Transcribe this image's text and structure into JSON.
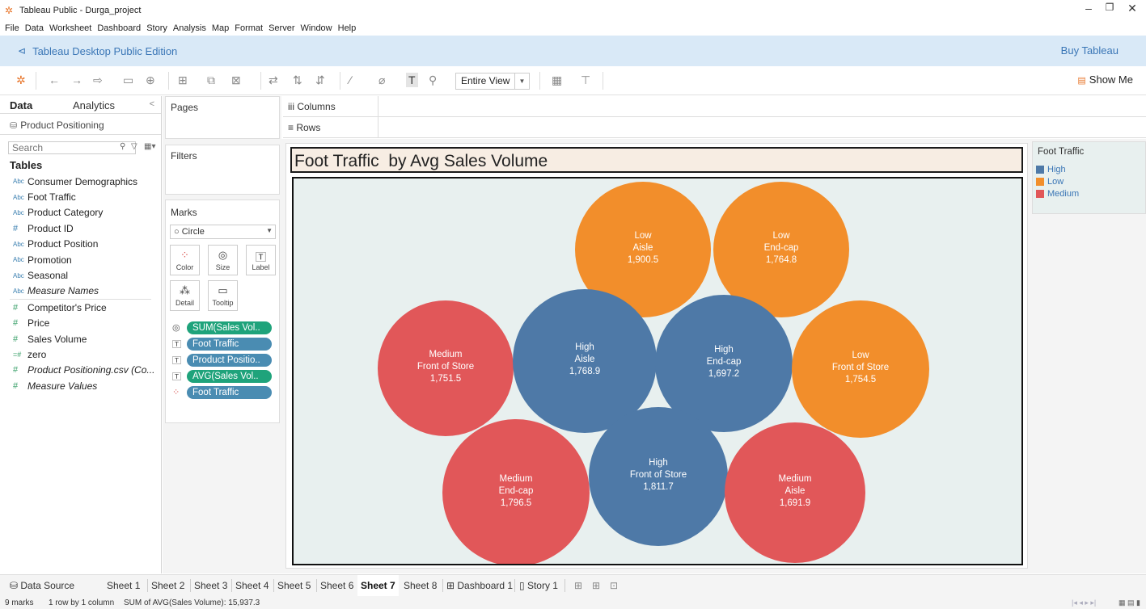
{
  "window": {
    "title": "Tableau Public - Durga_project",
    "icon": "tableau-logo-icon"
  },
  "menu": [
    "File",
    "Data",
    "Worksheet",
    "Dashboard",
    "Story",
    "Analysis",
    "Map",
    "Format",
    "Server",
    "Window",
    "Help"
  ],
  "edition": {
    "label": "Tableau Desktop Public Edition",
    "buy": "Buy Tableau"
  },
  "toolbar": {
    "fit": "Entire View",
    "show_me": "Show Me"
  },
  "data_pane": {
    "tab_data": "Data",
    "tab_analytics": "Analytics",
    "datasource": "Product Positioning",
    "search_placeholder": "Search",
    "tables_heading": "Tables",
    "dimensions": [
      {
        "type": "Abc",
        "name": "Consumer Demographics"
      },
      {
        "type": "Abc",
        "name": "Foot Traffic"
      },
      {
        "type": "Abc",
        "name": "Product Category"
      },
      {
        "type": "#",
        "name": "Product ID"
      },
      {
        "type": "Abc",
        "name": "Product Position"
      },
      {
        "type": "Abc",
        "name": "Promotion"
      },
      {
        "type": "Abc",
        "name": "Seasonal"
      },
      {
        "type": "Abc",
        "name": "Measure Names"
      }
    ],
    "measures": [
      {
        "type": "#",
        "name": "Competitor's Price"
      },
      {
        "type": "#",
        "name": "Price"
      },
      {
        "type": "#",
        "name": "Sales Volume"
      },
      {
        "type": "=#",
        "name": "zero"
      },
      {
        "type": "#",
        "name": "Product Positioning.csv (Co..."
      },
      {
        "type": "#",
        "name": "Measure Values"
      }
    ]
  },
  "cards": {
    "pages": "Pages",
    "filters": "Filters",
    "marks": "Marks",
    "mark_type": "Circle",
    "buttons": {
      "color": "Color",
      "size": "Size",
      "label": "Label",
      "detail": "Detail",
      "tooltip": "Tooltip"
    },
    "pills": [
      {
        "icon": "size-icon",
        "text": "SUM(Sales Vol..",
        "color": "green"
      },
      {
        "icon": "label-icon",
        "text": "Foot Traffic",
        "color": "blue"
      },
      {
        "icon": "label-icon",
        "text": "Product Positio..",
        "color": "blue"
      },
      {
        "icon": "label-icon",
        "text": "AVG(Sales Vol..",
        "color": "green"
      },
      {
        "icon": "color-icon",
        "text": "Foot Traffic",
        "color": "blue"
      }
    ]
  },
  "shelves": {
    "columns": "Columns",
    "rows": "Rows"
  },
  "sheet_title": "Foot Traffic  by Avg Sales Volume",
  "legend": {
    "title": "Foot Traffic",
    "items": [
      {
        "label": "High",
        "color": "#4e79a7"
      },
      {
        "label": "Low",
        "color": "#f28e2b"
      },
      {
        "label": "Medium",
        "color": "#e15759"
      }
    ]
  },
  "chart_data": {
    "type": "packed-bubble",
    "title": "Foot Traffic  by Avg Sales Volume",
    "size_measure": "SUM(Sales Volume)",
    "label_measure": "AVG(Sales Volume)",
    "color_dimension": "Foot Traffic",
    "colors": {
      "High": "#4e79a7",
      "Low": "#f28e2b",
      "Medium": "#e15759"
    },
    "bubbles": [
      {
        "foot_traffic": "Low",
        "position": "Aisle",
        "value": "1,900.5"
      },
      {
        "foot_traffic": "Low",
        "position": "End-cap",
        "value": "1,764.8"
      },
      {
        "foot_traffic": "Medium",
        "position": "Front of Store",
        "value": "1,751.5"
      },
      {
        "foot_traffic": "High",
        "position": "Aisle",
        "value": "1,768.9"
      },
      {
        "foot_traffic": "High",
        "position": "End-cap",
        "value": "1,697.2"
      },
      {
        "foot_traffic": "Low",
        "position": "Front of Store",
        "value": "1,754.5"
      },
      {
        "foot_traffic": "Medium",
        "position": "End-cap",
        "value": "1,796.5"
      },
      {
        "foot_traffic": "High",
        "position": "Front of Store",
        "value": "1,811.7"
      },
      {
        "foot_traffic": "Medium",
        "position": "Aisle",
        "value": "1,691.9"
      }
    ]
  },
  "tabs": {
    "data_source": "Data Source",
    "sheets": [
      "Sheet 1",
      "Sheet 2",
      "Sheet 3",
      "Sheet 4",
      "Sheet 5",
      "Sheet 6",
      "Sheet 7",
      "Sheet 8"
    ],
    "active": "Sheet 7",
    "dashboard": "Dashboard 1",
    "story": "Story 1"
  },
  "status": {
    "marks": "9 marks",
    "dims": "1 row by 1 column",
    "sum": "SUM of AVG(Sales Volume): 15,937.3"
  }
}
